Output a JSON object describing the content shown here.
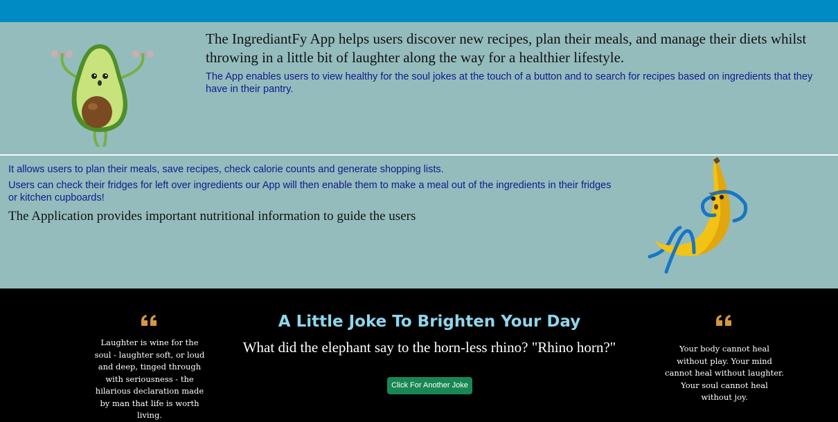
{
  "header": {
    "bar_color": "#008bc5"
  },
  "intro": {
    "heading": "The IngrediantFy App helps users discover new recipes, plan their meals, and manage their diets whilst throwing in a little bit of laughter along the way for a healthier lifestyle.",
    "body": "The App enables users to view healthy for the soul jokes at the touch of a button and to search for recipes based on ingredients that they have in their pantry.",
    "image_icon": "avocado-workout-icon"
  },
  "features": {
    "line1": "It allows users to plan their meals, save recipes, check calorie counts and generate shopping lists.",
    "line2": "Users can check their fridges for left over ingredients our App will then enable them to make a meal out of the ingredients in their fridges or kitchen cupboards!",
    "line3": "The Application provides important nutritional information to guide the users",
    "image_icon": "banana-situp-icon"
  },
  "joke_section": {
    "title": "A Little Joke To Brighten Your Day",
    "joke": "What did the elephant say to the horn-less rhino? \"Rhino horn?\"",
    "button_label": "Click For Another Joke",
    "quote_left": "Laughter is wine for the soul - laughter soft, or loud and deep, tinged through with seriousness - the hilarious declaration made by man that life is worth living.",
    "quote_right": "Your body cannot heal without play. Your mind cannot heal without laughter. Your soul cannot heal without joy.",
    "quote_icon": "quote-mark-icon"
  },
  "colors": {
    "teal_bg": "#94bcbd",
    "accent_blue": "#0f1b8c",
    "joke_title": "#8fd6ec",
    "quote_gold": "#d79645",
    "button_green": "#198754"
  }
}
